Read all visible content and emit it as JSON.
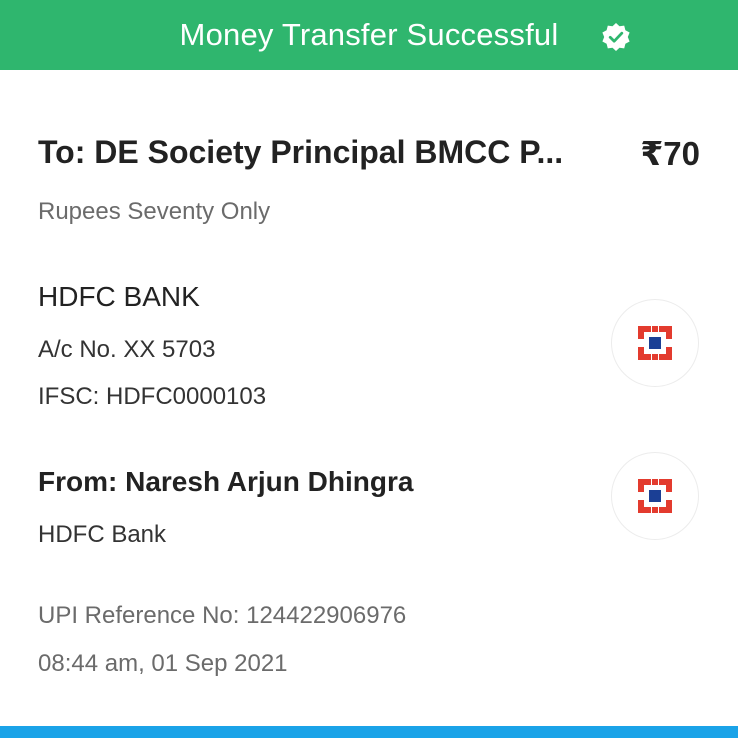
{
  "header": {
    "title": "Money Transfer Successful",
    "icon": "verified-check-icon",
    "background": "#2fb66e"
  },
  "payee": {
    "to_label": "To: DE Society Principal BMCC P...",
    "amount": "₹70",
    "amount_words": "Rupees Seventy Only",
    "bank_name": "HDFC BANK",
    "account_no": "A/c No.  XX 5703",
    "ifsc": "IFSC: HDFC0000103",
    "bank_logo_icon": "hdfc-bank-logo-icon"
  },
  "payer": {
    "from_label": "From: Naresh Arjun Dhingra",
    "bank_name": "HDFC Bank",
    "bank_logo_icon": "hdfc-bank-logo-icon"
  },
  "transaction": {
    "upi_reference": "UPI Reference No: 124422906976",
    "datetime": "08:44 am, 01 Sep 2021"
  },
  "colors": {
    "success_green": "#2fb66e",
    "hdfc_red": "#e33b2e",
    "hdfc_blue": "#1b3f95",
    "bottom_bar_blue": "#1aa3e8"
  }
}
